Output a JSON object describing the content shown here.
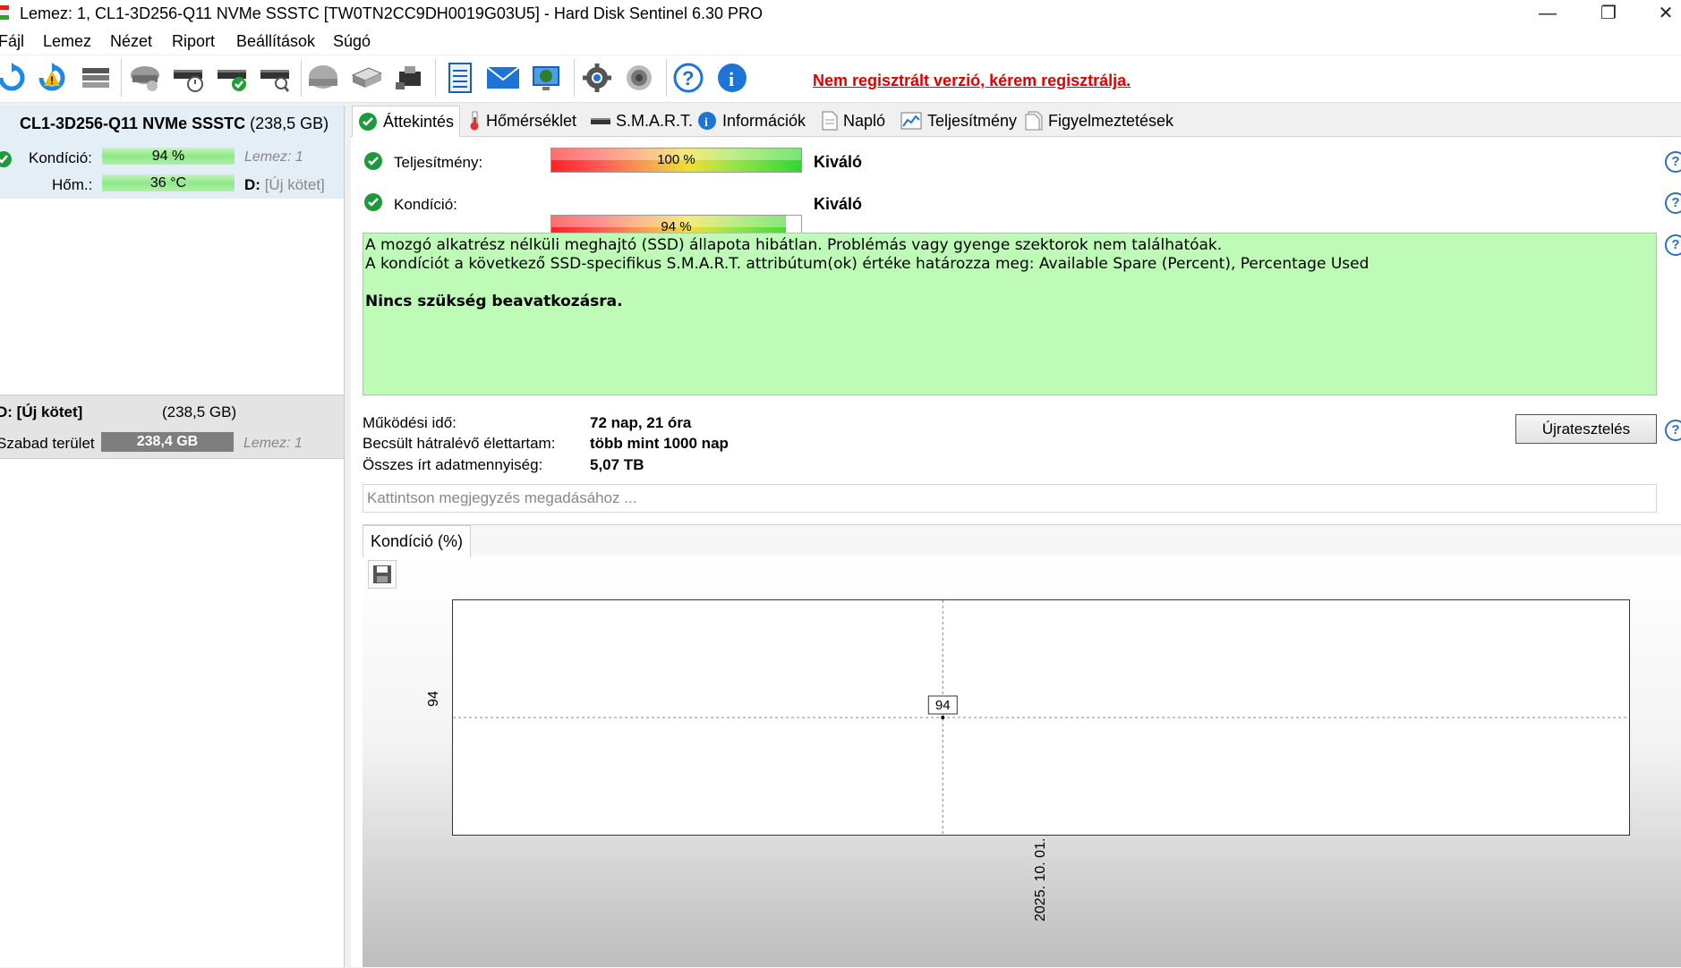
{
  "window": {
    "title": "Lemez: 1, CL1-3D256-Q11 NVMe SSSTC [TW0TN2CC9DH0019G03U5]  -  Hard Disk Sentinel 6.30 PRO",
    "minimize": "—",
    "restore": "❐",
    "close": "✕"
  },
  "menu": {
    "items": [
      "Fájl",
      "Lemez",
      "Nézet",
      "Riport",
      "Beállítások",
      "Súgó"
    ]
  },
  "toolbar": {
    "icons": [
      "refresh-icon",
      "refresh-warning-icon",
      "disk-list-icon",
      "disk-gray-icon",
      "disk-clock-icon",
      "disk-check-icon",
      "disk-search-icon",
      "hdd-icon",
      "drives-icon",
      "usb-drive-icon",
      "report-icon",
      "email-icon",
      "network-icon",
      "settings-icon",
      "sound-icon",
      "help-icon",
      "info-icon"
    ],
    "registration_notice": "Nem regisztrált verzió, kérem regisztrálja."
  },
  "left_panel": {
    "disk": {
      "name": "CL1-3D256-Q11 NVMe SSSTC",
      "size": "(238,5 GB)",
      "condition_label": "Kondíció:",
      "condition_value": "94 %",
      "condition_level": 94,
      "temp_label": "Hőm.:",
      "temp_value": "36 °C",
      "disk_label": "Lemez: 1",
      "drive_letter": "D:",
      "volume_hint": "[Új kötet]"
    },
    "volume": {
      "name": "D: [Új kötet]",
      "size": "(238,5 GB)",
      "free_label": "Szabad terület",
      "free_value": "238,4 GB",
      "free_fraction": 1.0,
      "disk_label": "Lemez: 1"
    }
  },
  "tabs": [
    {
      "label": "Áttekintés",
      "icon": "check-icon"
    },
    {
      "label": "Hőmérséklet",
      "icon": "thermometer-icon"
    },
    {
      "label": "S.M.A.R.T.",
      "icon": "drive-icon"
    },
    {
      "label": "Információk",
      "icon": "info-icon"
    },
    {
      "label": "Napló",
      "icon": "log-icon"
    },
    {
      "label": "Teljesítmény",
      "icon": "performance-icon"
    },
    {
      "label": "Figyelmeztetések",
      "icon": "alerts-icon"
    }
  ],
  "overview": {
    "performance_label": "Teljesítmény:",
    "performance_value": "100 %",
    "performance_level": 100,
    "performance_rating": "Kiváló",
    "condition_label": "Kondíció:",
    "condition_value": "94 %",
    "condition_level": 94,
    "condition_rating": "Kiváló",
    "status_lines": [
      "A mozgó alkatrész nélküli meghajtó (SSD) állapota hibátlan. Problémás vagy gyenge szektorok nem találhatóak.",
      "A kondíciót a következő SSD-specifikus S.M.A.R.T. attribútum(ok) értéke határozza meg:  Available Spare (Percent), Percentage Used"
    ],
    "status_action": "Nincs szükség beavatkozásra.",
    "status_color": "#bdfbb7",
    "uptime_label": "Működési idő:",
    "uptime_value": "72 nap, 21 óra",
    "lifetime_label": "Becsült hátralévő élettartam:",
    "lifetime_value": "több mint 1000 nap",
    "written_label": "Összes írt adatmennyiség:",
    "written_value": "5,07 TB",
    "retest_button": "Újratesztelés",
    "note_placeholder": "Kattintson megjegyzés megadásához ..."
  },
  "chart_tab": "Kondíció  (%)",
  "chart_data": {
    "type": "line",
    "x": [
      "2025. 10. 01."
    ],
    "values": [
      94
    ],
    "y_tick_labels": [
      "94"
    ],
    "x_tick_labels": [
      "2025. 10. 01."
    ],
    "data_labels": [
      "94"
    ],
    "grid": true
  }
}
